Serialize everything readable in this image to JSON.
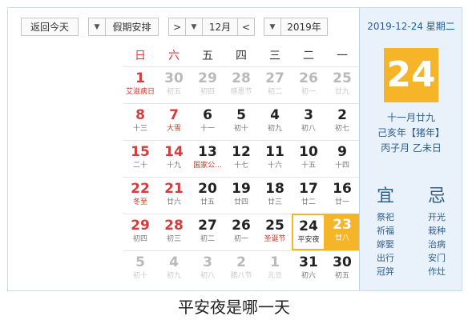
{
  "toolbar": {
    "return_today": "返回今天",
    "holiday_select": "假期安排",
    "month_select": "12月",
    "year_select": "2019年",
    "prev_icon": "chevron-left-icon",
    "next_icon": "chevron-right-icon",
    "dropdown_icon": "caret-down-icon"
  },
  "weekdays": [
    "日",
    "六",
    "五",
    "四",
    "三",
    "二",
    "一"
  ],
  "weeks": [
    [
      {
        "day": "1",
        "lunar": "艾滋病日",
        "weekend": true,
        "festival": true
      },
      {
        "day": "30",
        "lunar": "初五",
        "weekend": true,
        "other": true
      },
      {
        "day": "29",
        "lunar": "初四",
        "other": true
      },
      {
        "day": "28",
        "lunar": "感恩节",
        "other": true
      },
      {
        "day": "27",
        "lunar": "初二",
        "other": true
      },
      {
        "day": "26",
        "lunar": "初一",
        "other": true
      },
      {
        "day": "25",
        "lunar": "廿九",
        "other": true
      }
    ],
    [
      {
        "day": "8",
        "lunar": "十三",
        "weekend": true
      },
      {
        "day": "7",
        "lunar": "大雪",
        "weekend": true,
        "festival": true
      },
      {
        "day": "6",
        "lunar": "十一"
      },
      {
        "day": "5",
        "lunar": "初十"
      },
      {
        "day": "4",
        "lunar": "初九"
      },
      {
        "day": "3",
        "lunar": "初八"
      },
      {
        "day": "2",
        "lunar": "初七"
      }
    ],
    [
      {
        "day": "15",
        "lunar": "二十",
        "weekend": true
      },
      {
        "day": "14",
        "lunar": "十九",
        "weekend": true
      },
      {
        "day": "13",
        "lunar": "国家公...",
        "festival": true
      },
      {
        "day": "12",
        "lunar": "十七"
      },
      {
        "day": "11",
        "lunar": "十六"
      },
      {
        "day": "10",
        "lunar": "十五"
      },
      {
        "day": "9",
        "lunar": "十四"
      }
    ],
    [
      {
        "day": "22",
        "lunar": "冬至",
        "weekend": true,
        "festival": true
      },
      {
        "day": "21",
        "lunar": "廿六",
        "weekend": true
      },
      {
        "day": "20",
        "lunar": "廿五"
      },
      {
        "day": "19",
        "lunar": "廿四"
      },
      {
        "day": "18",
        "lunar": "廿三"
      },
      {
        "day": "17",
        "lunar": "廿二"
      },
      {
        "day": "16",
        "lunar": "廿一"
      }
    ],
    [
      {
        "day": "29",
        "lunar": "初四",
        "weekend": true
      },
      {
        "day": "28",
        "lunar": "初三",
        "weekend": true
      },
      {
        "day": "27",
        "lunar": "初二"
      },
      {
        "day": "26",
        "lunar": "初一"
      },
      {
        "day": "25",
        "lunar": "圣诞节",
        "festival": true
      },
      {
        "day": "24",
        "lunar": "平安夜",
        "selected": true
      },
      {
        "day": "23",
        "lunar": "廿八",
        "today": true
      }
    ],
    [
      {
        "day": "5",
        "lunar": "初十",
        "weekend": true,
        "other": true
      },
      {
        "day": "4",
        "lunar": "初九",
        "weekend": true,
        "other": true
      },
      {
        "day": "3",
        "lunar": "初八",
        "other": true
      },
      {
        "day": "2",
        "lunar": "腊八节",
        "other": true
      },
      {
        "day": "1",
        "lunar": "元旦",
        "other": true
      },
      {
        "day": "31",
        "lunar": "初六"
      },
      {
        "day": "30",
        "lunar": "初五"
      }
    ]
  ],
  "side": {
    "date_line": "2019-12-24 星期二",
    "big_day": "24",
    "lunar_lines": [
      "十一月廿九",
      "己亥年【猪年】",
      "丙子月 乙未日"
    ],
    "yi_title": "宜",
    "yi_items": [
      "祭祀",
      "祈福",
      "嫁娶",
      "出行",
      "冠笄"
    ],
    "ji_title": "忌",
    "ji_items": [
      "开光",
      "栽种",
      "治病",
      "安门",
      "作灶"
    ]
  },
  "caption": "平安夜是哪一天",
  "colors": {
    "accent": "#f6b528",
    "weekend": "#d63c3c",
    "panel": "#e9f1fa",
    "panel_text": "#2f5e8c"
  }
}
